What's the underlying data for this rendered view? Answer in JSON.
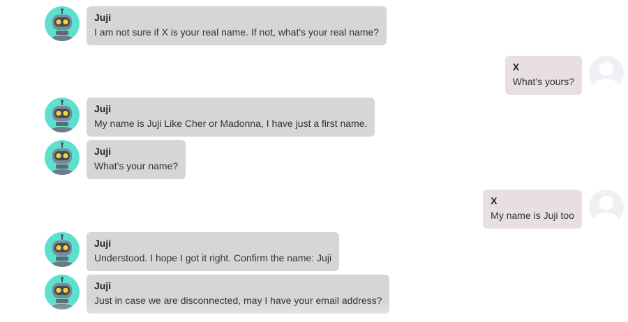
{
  "colors": {
    "bot_bubble": "#d6d6d6",
    "user_bubble": "#e8dfe0",
    "bot_avatar_bg": "#5ee0cf",
    "user_avatar_bg": "#eef0f3"
  },
  "icons": {
    "bot": "robot-icon",
    "user": "user-silhouette-icon"
  },
  "messages": [
    {
      "from": "bot",
      "sender": "Juji",
      "text": "I am not sure if X is your real name. If not, what's your real name?"
    },
    {
      "from": "user",
      "sender": "X",
      "text": "What's yours?"
    },
    {
      "from": "bot",
      "sender": "Juji",
      "text": "My name is Juji Like Cher or Madonna, I have just a first name."
    },
    {
      "from": "bot",
      "sender": "Juji",
      "text": "What's your name?"
    },
    {
      "from": "user",
      "sender": "X",
      "text": "My name is Juji too"
    },
    {
      "from": "bot",
      "sender": "Juji",
      "text": "Understood. I hope I got it right. Confirm the name: Juji"
    },
    {
      "from": "bot",
      "sender": "Juji",
      "text": "Just in case we are disconnected, may I have your email address?"
    }
  ]
}
